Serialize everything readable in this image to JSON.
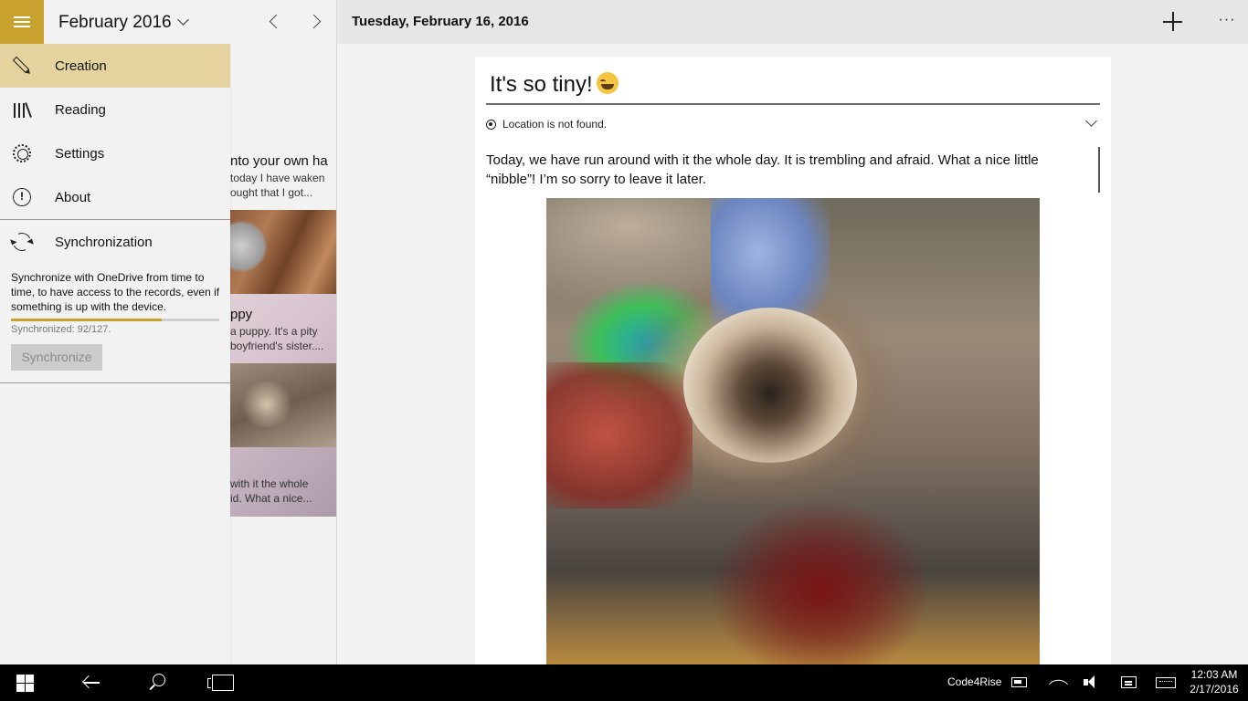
{
  "list_header": {
    "month": "February 2016"
  },
  "entries": [
    {
      "line1": "nto your own ha",
      "line2": "today I have waken",
      "line3": "ought that I got..."
    },
    {
      "title": "ppy",
      "line1": "a puppy. It's a pity",
      "line2": "boyfriend's sister...."
    },
    {
      "line1": "with it the whole",
      "line2": "id. What a nice..."
    }
  ],
  "side_menu": {
    "items": [
      {
        "label": "Creation",
        "icon": "pencil-icon",
        "selected": true
      },
      {
        "label": "Reading",
        "icon": "books-icon"
      },
      {
        "label": "Settings",
        "icon": "gear-icon"
      },
      {
        "label": "About",
        "icon": "info-icon"
      }
    ],
    "sync": {
      "label": "Synchronization",
      "icon": "sync-icon",
      "description": "Synchronize with OneDrive from time to time, to have access to the records, even if something is up with the device.",
      "progress_fraction": 0.724,
      "status": "Synchronized: 92/127.",
      "button_label": "Synchronize"
    }
  },
  "entry": {
    "date": "Tuesday, February 16, 2016",
    "title": "It's so tiny!",
    "title_emoji": "laughing-face-emoji",
    "location": "Location is not found.",
    "body": "Today, we have run around with it the whole day. It is trembling and afraid. What a nice little “nibble”! I’m so sorry to leave it later.",
    "photo": "puppy-photo"
  },
  "toolbar": {
    "add_icon": "plus-icon",
    "more_label": "···"
  },
  "taskbar": {
    "app_label": "Code4Rise",
    "time": "12:03 AM",
    "date": "2/17/2016"
  },
  "colors": {
    "accent": "#c9a12e",
    "selected_bg": "#e5d39f",
    "header_bg": "#e6e6e6",
    "taskbar_bg": "#000000"
  }
}
